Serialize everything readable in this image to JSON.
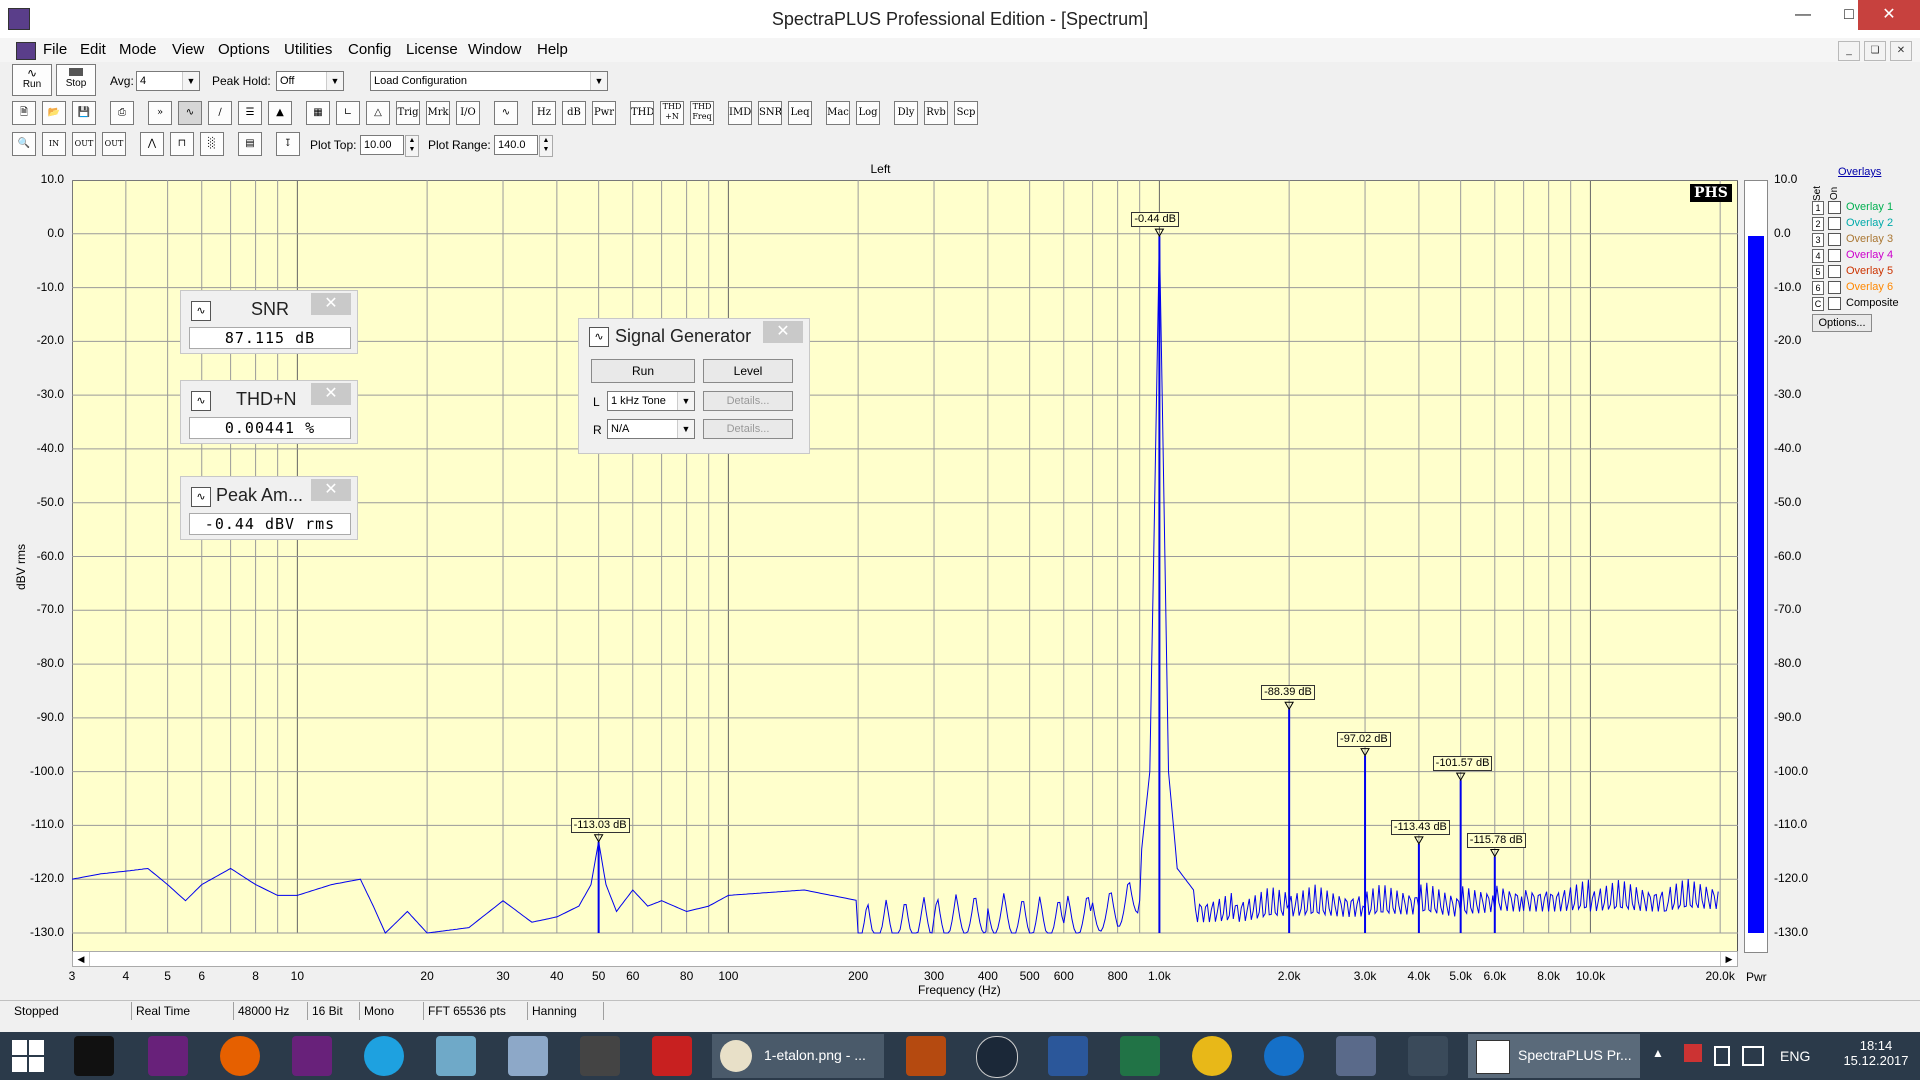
{
  "window": {
    "title": "SpectraPLUS Professional Edition - [Spectrum]"
  },
  "menu": [
    "File",
    "Edit",
    "Mode",
    "View",
    "Options",
    "Utilities",
    "Config",
    "License",
    "Window",
    "Help"
  ],
  "toolbar1": {
    "run_label": "Run",
    "stop_label": "Stop",
    "avg_label": "Avg:",
    "avg_value": "4",
    "peak_hold_label": "Peak Hold:",
    "peak_hold_value": "Off",
    "load_config_value": "Load Configuration"
  },
  "toolbar2": [
    "Trig",
    "Mrk",
    "I/O",
    "Hz",
    "dB",
    "Pwr",
    "THD",
    "THD +N",
    "THD Freq",
    "IMD",
    "SNR",
    "Leq",
    "Mac",
    "Log",
    "Dly",
    "Rvb",
    "Scp"
  ],
  "toolbar3": {
    "plot_top_label": "Plot Top:",
    "plot_top_value": "10.00",
    "plot_range_label": "Plot Range:",
    "plot_range_value": "140.0"
  },
  "plot": {
    "channel_label": "Left",
    "y_axis_label": "dBV rms",
    "x_axis_label": "Frequency (Hz)",
    "logo": "PHS",
    "right_bar_label": "Pwr"
  },
  "chart_data": {
    "type": "line",
    "xscale": "log",
    "xlim": [
      3,
      22000
    ],
    "ylim": [
      -130,
      10
    ],
    "ylabel": "dBV rms",
    "xlabel": "Frequency (Hz)",
    "y_ticks": [
      "10.0",
      "0.0",
      "-10.0",
      "-20.0",
      "-30.0",
      "-40.0",
      "-50.0",
      "-60.0",
      "-70.0",
      "-80.0",
      "-90.0",
      "-100.0",
      "-110.0",
      "-120.0",
      "-130.0"
    ],
    "x_ticks": [
      "3",
      "4",
      "5",
      "6",
      "8",
      "10",
      "20",
      "30",
      "40",
      "50",
      "60",
      "80",
      "100",
      "200",
      "300",
      "400",
      "500",
      "600",
      "800",
      "1.0k",
      "2.0k",
      "3.0k",
      "4.0k",
      "5.0k",
      "6.0k",
      "8.0k",
      "10.0k",
      "20.0k"
    ],
    "grid": true,
    "markers": [
      {
        "freq": 50,
        "db": -113.03,
        "label": "-113.03 dB"
      },
      {
        "freq": 1000,
        "db": -0.44,
        "label": "-0.44 dB"
      },
      {
        "freq": 2000,
        "db": -88.39,
        "label": "-88.39 dB"
      },
      {
        "freq": 3000,
        "db": -97.02,
        "label": "-97.02 dB"
      },
      {
        "freq": 4000,
        "db": -113.43,
        "label": "-113.43 dB"
      },
      {
        "freq": 5000,
        "db": -101.57,
        "label": "-101.57 dB"
      },
      {
        "freq": 6000,
        "db": -115.78,
        "label": "-115.78 dB"
      }
    ],
    "series": [
      {
        "color": "#0000ee",
        "x": [
          3,
          3.5,
          4,
          4.5,
          5,
          5.5,
          6,
          7,
          8,
          9,
          10,
          12,
          14,
          15,
          16,
          18,
          20,
          25,
          30,
          35,
          40,
          45,
          48,
          50,
          52,
          55,
          60,
          65,
          70,
          80,
          90,
          100,
          150,
          200,
          300,
          400,
          500,
          600,
          700,
          800,
          900,
          950,
          980,
          1000,
          1020,
          1050,
          1100,
          1200,
          1500,
          2000,
          3000,
          4000,
          5000,
          6000,
          7000,
          8000,
          10000,
          15000,
          20000
        ],
        "y": [
          -120,
          -119,
          -118.5,
          -118,
          -121,
          -124,
          -121,
          -118,
          -121,
          -123,
          -123,
          -121,
          -120,
          -125,
          -130,
          -126,
          -130,
          -129,
          -124,
          -128,
          -127,
          -125,
          -121,
          -113,
          -121,
          -126,
          -122,
          -125,
          -124,
          -126,
          -125,
          -123,
          -122,
          -124,
          -123,
          -122,
          -123,
          -123,
          -122,
          -121,
          -118,
          -100,
          -40,
          -0.44,
          -40,
          -100,
          -118,
          -122,
          -122,
          -121,
          -121,
          -120.5,
          -121,
          -120,
          -120,
          -120,
          -120,
          -120,
          -119.5
        ]
      }
    ]
  },
  "right_bar": {
    "level_db": -0.44,
    "color": "#0000ff",
    "ticks": [
      "10.0",
      "0.0",
      "-10.0",
      "-20.0",
      "-30.0",
      "-40.0",
      "-50.0",
      "-60.0",
      "-70.0",
      "-80.0",
      "-90.0",
      "-100.0",
      "-110.0",
      "-120.0",
      "-130.0"
    ]
  },
  "overlays": {
    "title": "Overlays",
    "set_label": "Set",
    "on_label": "On",
    "items": [
      {
        "num": "1",
        "label": "Overlay 1",
        "color": "#00b050"
      },
      {
        "num": "2",
        "label": "Overlay 2",
        "color": "#00aaaa"
      },
      {
        "num": "3",
        "label": "Overlay 3",
        "color": "#aa7733"
      },
      {
        "num": "4",
        "label": "Overlay 4",
        "color": "#cc00cc"
      },
      {
        "num": "5",
        "label": "Overlay 5",
        "color": "#cc3300"
      },
      {
        "num": "6",
        "label": "Overlay 6",
        "color": "#ff8800"
      },
      {
        "num": "C",
        "label": "Composite",
        "color": "#000000"
      }
    ],
    "options_button": "Options..."
  },
  "meters": {
    "snr": {
      "title": "SNR",
      "value": "87.115 dB"
    },
    "thdn": {
      "title": "THD+N",
      "value": "0.00441 %"
    },
    "peak": {
      "title": "Peak Am...",
      "value": "-0.44 dBV rms"
    }
  },
  "signal_generator": {
    "title": "Signal Generator",
    "run_label": "Run",
    "level_label": "Level",
    "left_label": "L",
    "left_value": "1 kHz Tone",
    "right_label": "R",
    "right_value": "N/A",
    "details_label": "Details..."
  },
  "statusbar": [
    "Stopped",
    "Real Time",
    "48000 Hz",
    "16 Bit",
    "Mono",
    "FFT 65536 pts",
    "Hanning"
  ],
  "taskbar": {
    "active_label": "1-etalon.png - ...",
    "app_label": "SpectraPLUS Pr...",
    "lang": "ENG",
    "time": "18:14",
    "date": "15.12.2017"
  }
}
